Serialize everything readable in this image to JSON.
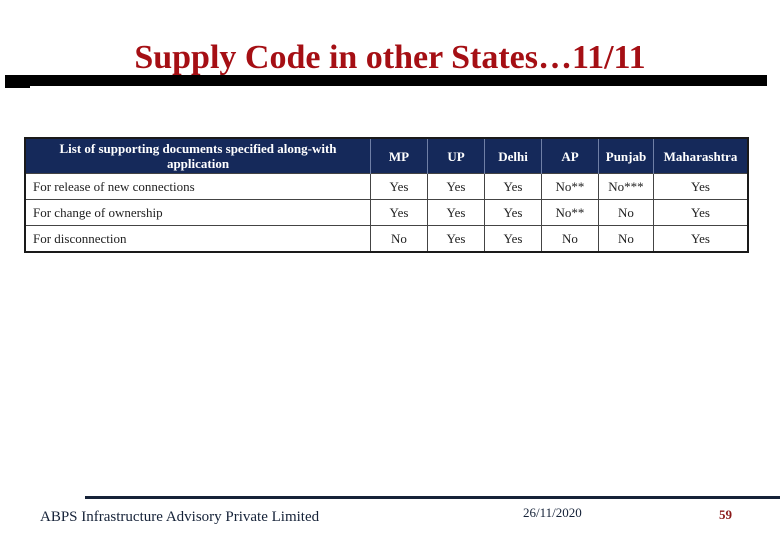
{
  "slide": {
    "title": "Supply Code in other States…11/11"
  },
  "table": {
    "headers": [
      "List of supporting documents specified along-with application",
      "MP",
      "UP",
      "Delhi",
      "AP",
      "Punjab",
      "Maharashtra"
    ],
    "rows": [
      [
        "For release of new connections",
        "Yes",
        "Yes",
        "Yes",
        "No**",
        "No***",
        "Yes"
      ],
      [
        "For change of ownership",
        "Yes",
        "Yes",
        "Yes",
        "No**",
        "No",
        "Yes"
      ],
      [
        "For disconnection",
        "No",
        "Yes",
        "Yes",
        "No",
        "No",
        "Yes"
      ]
    ]
  },
  "footer": {
    "company": "ABPS Infrastructure Advisory Private Limited",
    "date": "26/11/2020",
    "page_number": "59"
  },
  "colors": {
    "title": "#a50f14",
    "header_bg": "#15295a",
    "page_number": "#8b1a1a"
  }
}
